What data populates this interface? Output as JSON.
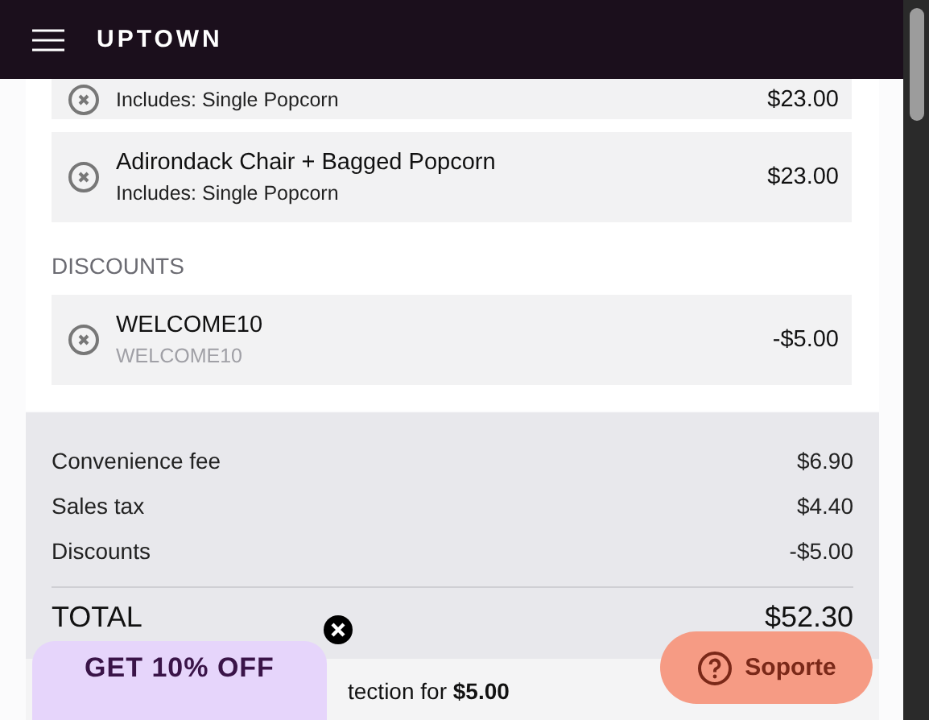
{
  "header": {
    "brand": "UPTOWN"
  },
  "items": [
    {
      "subtitle": "Includes: Single Popcorn",
      "price": "$23.00"
    },
    {
      "title": "Adirondack Chair + Bagged Popcorn",
      "subtitle": "Includes: Single Popcorn",
      "price": "$23.00"
    }
  ],
  "discounts": {
    "heading": "DISCOUNTS",
    "items": [
      {
        "title": "WELCOME10",
        "subtitle": "WELCOME10",
        "price": "-$5.00"
      }
    ]
  },
  "summary": {
    "rows": [
      {
        "label": "Convenience fee",
        "value": "$6.90"
      },
      {
        "label": "Sales tax",
        "value": "$4.40"
      },
      {
        "label": "Discounts",
        "value": "-$5.00"
      }
    ],
    "total": {
      "label": "TOTAL",
      "value": "$52.30"
    }
  },
  "protection": {
    "text": "tection for **$5.00**"
  },
  "promo": {
    "label": "GET 10% OFF"
  },
  "support": {
    "label": "Soporte"
  }
}
